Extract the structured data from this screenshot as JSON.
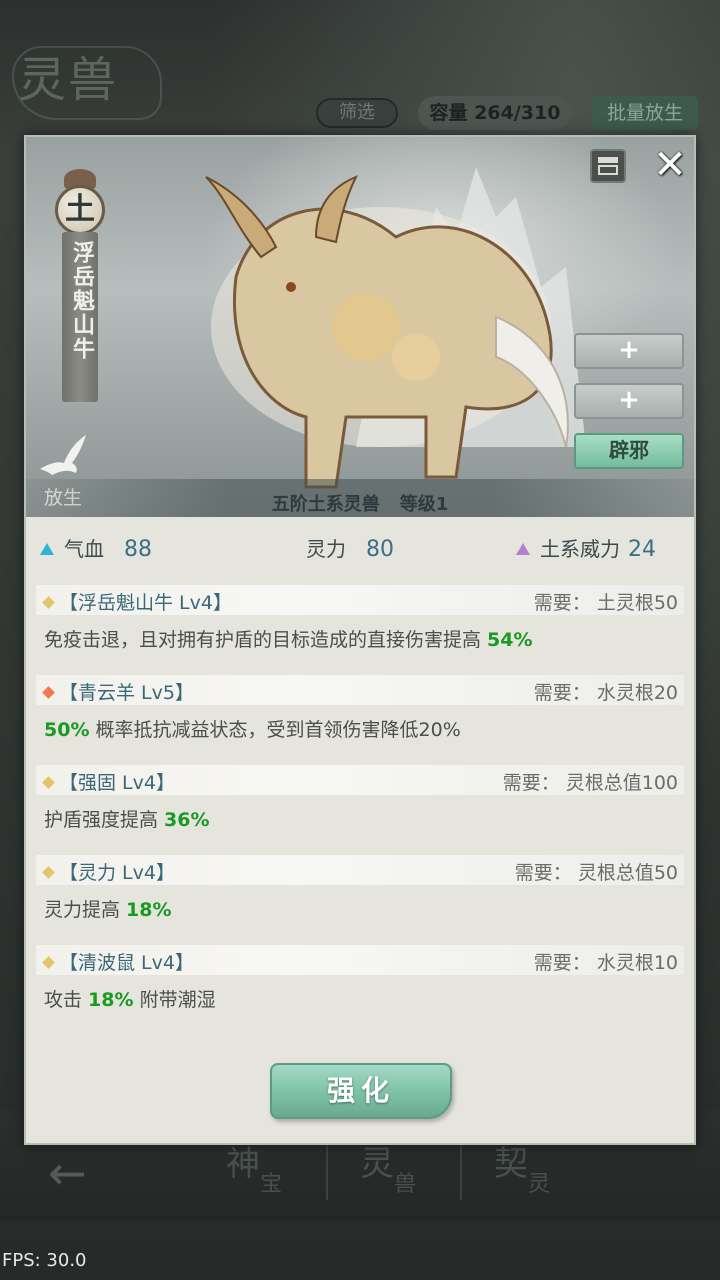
{
  "background": {
    "title": "灵兽",
    "filter_label": "筛选",
    "capacity_label": "容量 264/310",
    "batch_release_label": "批量放生",
    "nav": [
      {
        "big": "神",
        "small": "宝"
      },
      {
        "big": "灵",
        "small": "兽"
      },
      {
        "big": "契",
        "small": "灵"
      }
    ]
  },
  "fps": "FPS: 30.0",
  "beast": {
    "element": "土",
    "name": "浮岳魁山牛",
    "rank": "五阶土系灵兽",
    "level": "等级1",
    "release_label": "放生",
    "slots": [
      {
        "label": "+"
      },
      {
        "label": "+"
      },
      {
        "label": "辟邪"
      }
    ]
  },
  "stats": {
    "hp_label": "气血",
    "hp_value": "88",
    "spirit_label": "灵力",
    "spirit_value": "80",
    "power_label": "土系威力",
    "power_value": "24"
  },
  "skills": [
    {
      "name": "【浮岳魁山牛 Lv4】",
      "diamond_color": "#e2c56a",
      "requirement": "需要：  土灵根50",
      "desc_pre": "免疫击退，且对拥有护盾的目标造成的直接伤害提高 ",
      "desc_hl": "54%",
      "desc_post": ""
    },
    {
      "name": "【青云羊 Lv5】",
      "diamond_color": "#f07a4d",
      "requirement": "需要：  水灵根20",
      "desc_pre": "",
      "desc_hl": "50%",
      "desc_post": " 概率抵抗减益状态，受到首领伤害降低20%"
    },
    {
      "name": "【强固 Lv4】",
      "diamond_color": "#e2c56a",
      "requirement": "需要：  灵根总值100",
      "desc_pre": "护盾强度提高 ",
      "desc_hl": "36%",
      "desc_post": ""
    },
    {
      "name": "【灵力 Lv4】",
      "diamond_color": "#e2c56a",
      "requirement": "需要：  灵根总值50",
      "desc_pre": "灵力提高 ",
      "desc_hl": "18%",
      "desc_post": ""
    },
    {
      "name": "【清波鼠 Lv4】",
      "diamond_color": "#e2c56a",
      "requirement": "需要：  水灵根10",
      "desc_pre": "攻击 ",
      "desc_hl": "18%",
      "desc_post": " 附带潮湿"
    }
  ],
  "upgrade_label": "强化",
  "colors": {
    "accent_green": "#7cc1a7",
    "highlight_green": "#199a22",
    "value_blue": "#3a6f86"
  }
}
